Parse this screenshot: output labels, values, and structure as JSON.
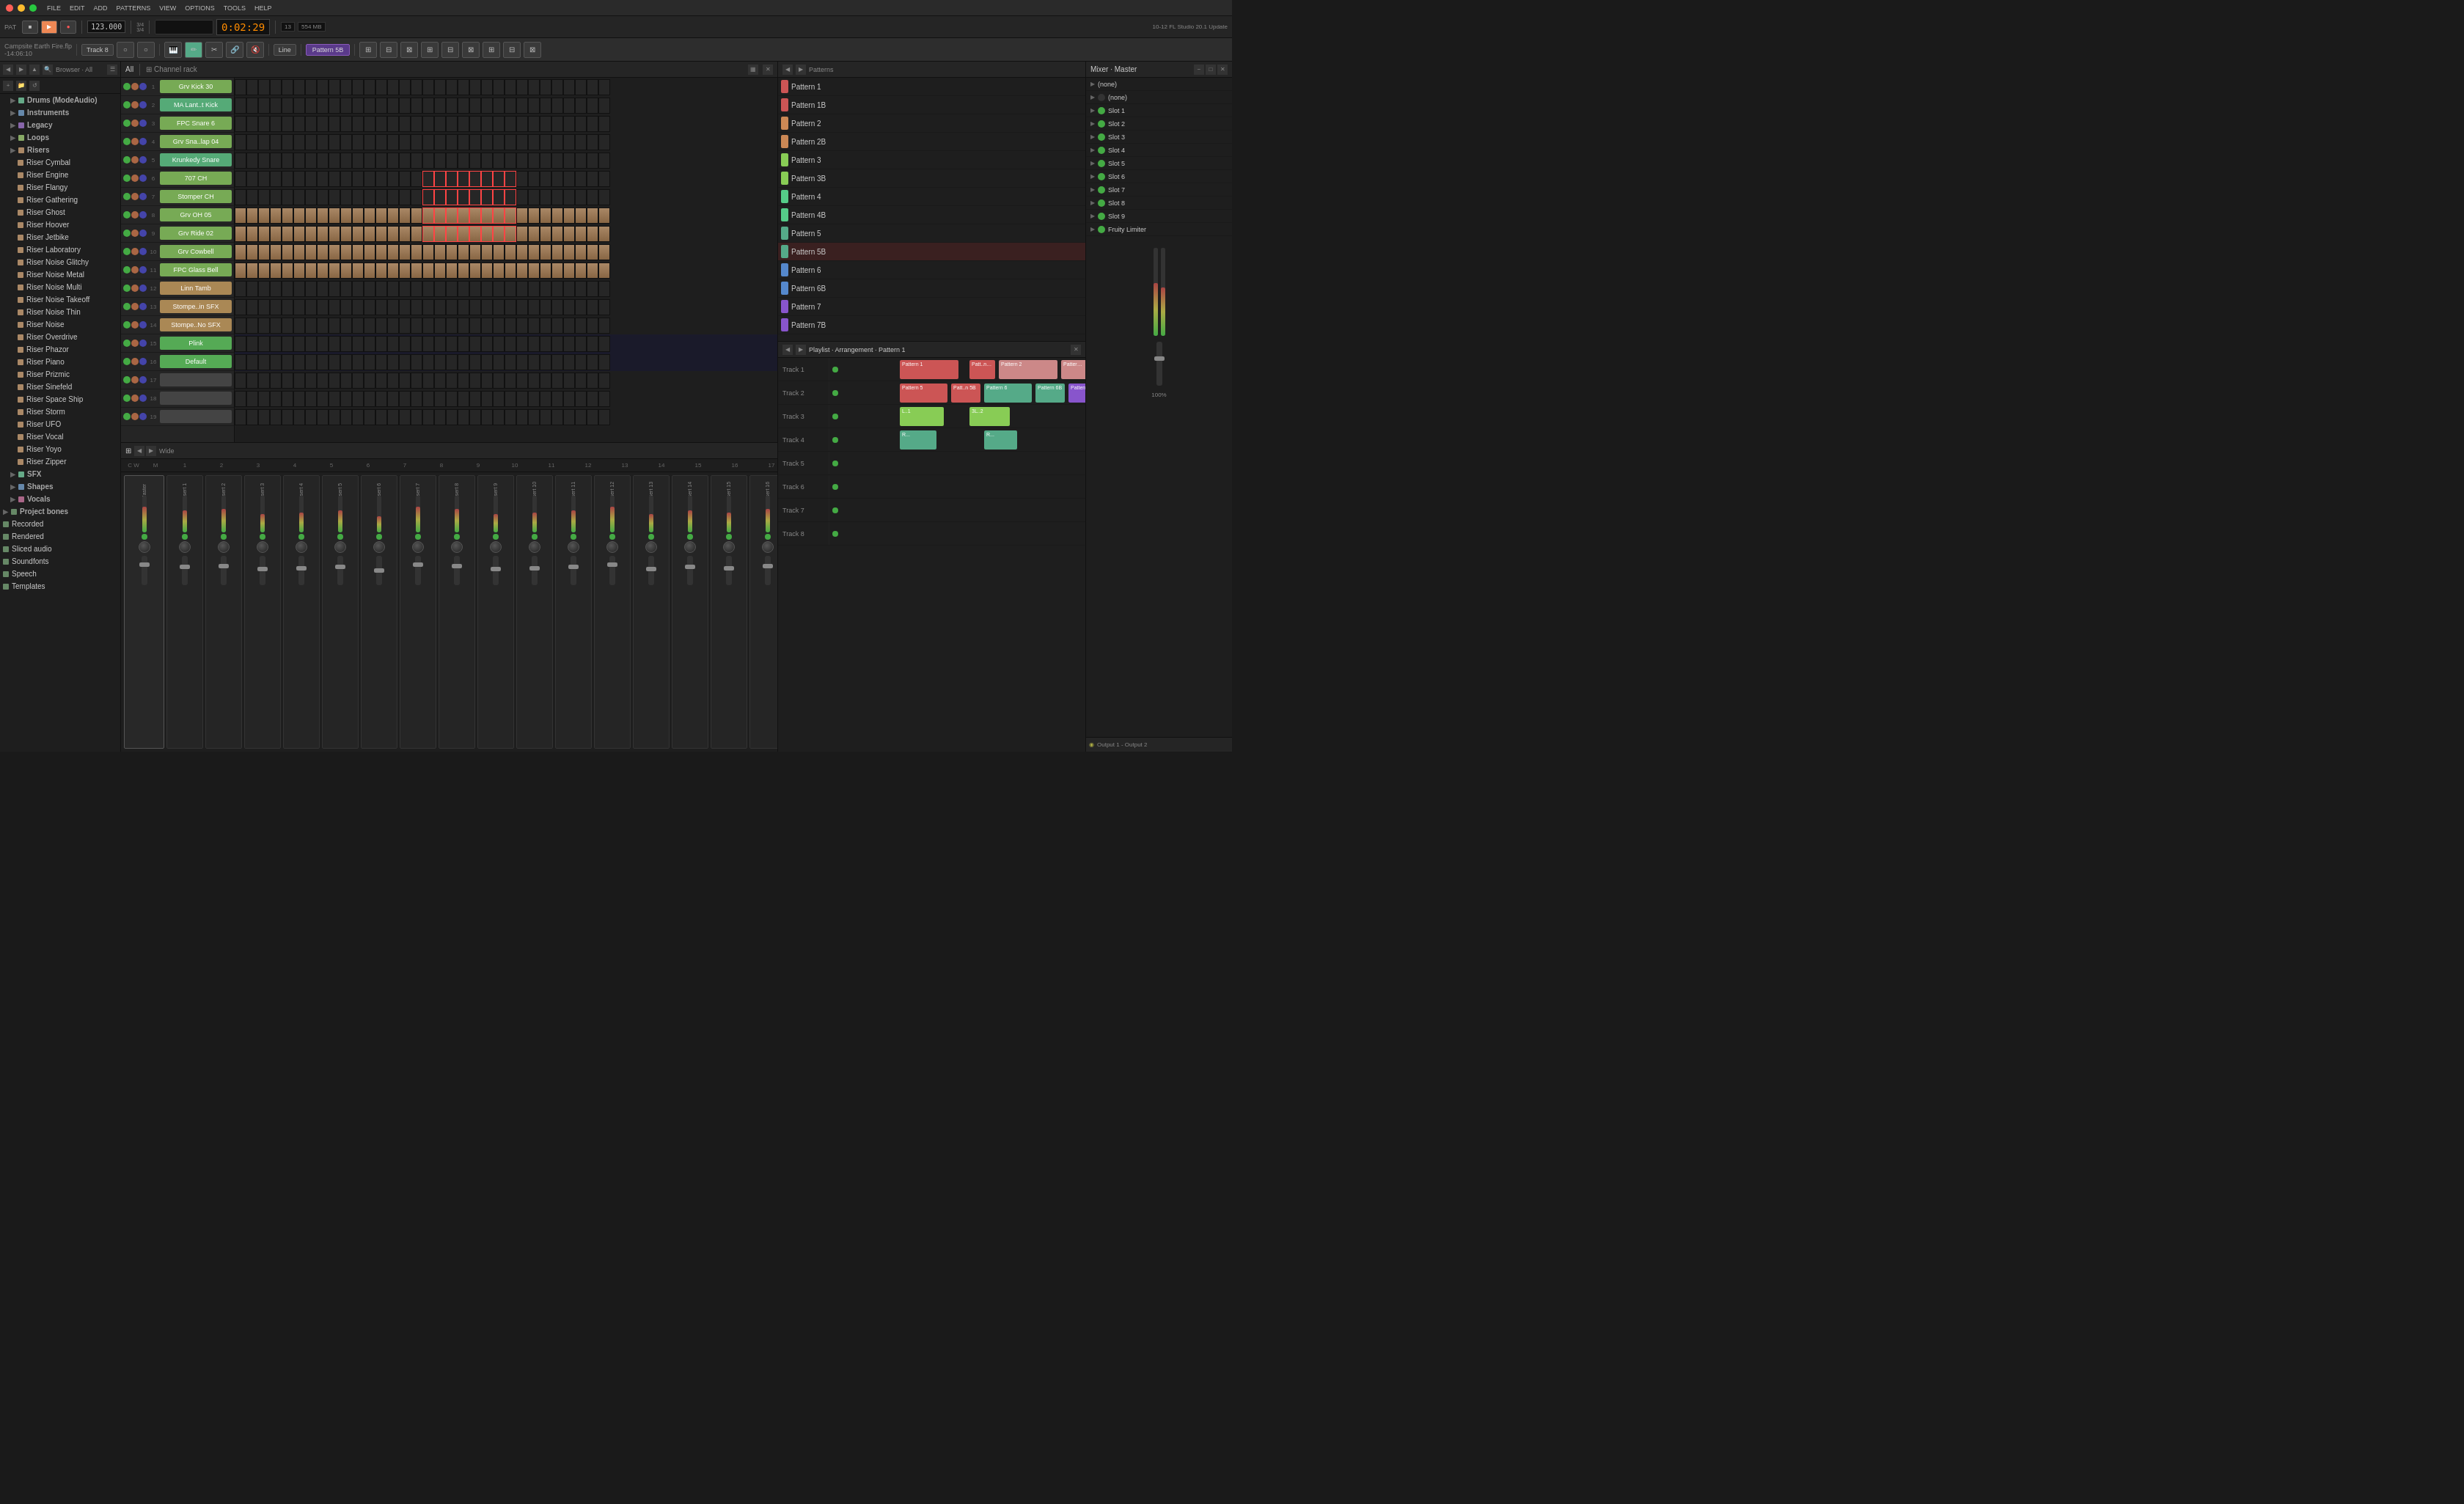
{
  "app": {
    "title": "FL Studio 20.1",
    "project": "Campsite Earth Fire.flp",
    "time_offset": "-14:06:10"
  },
  "titlebar": {
    "menus": [
      "FILE",
      "EDIT",
      "ADD",
      "PATTERNS",
      "VIEW",
      "OPTIONS",
      "TOOLS",
      "HELP"
    ],
    "pattern_label": "PAT"
  },
  "transport": {
    "bpm": "123.000",
    "time": "0:02:29",
    "track": "Track 8",
    "pattern": "Pattern 5B",
    "cpu": "13",
    "ram": "554 MB",
    "line_label": "Line",
    "update_label": "10-12  FL Studio 20.1\nUpdate"
  },
  "channel_rack": {
    "title": "Channel rack",
    "channels": [
      {
        "num": 1,
        "name": "Grv Kick 30",
        "color": "#7a5"
      },
      {
        "num": 2,
        "name": "MA Lant..t Kick",
        "color": "#5a7"
      },
      {
        "num": 3,
        "name": "FPC Snare 6",
        "color": "#7a5"
      },
      {
        "num": 4,
        "name": "Grv Sna..lap 04",
        "color": "#7a5"
      },
      {
        "num": 5,
        "name": "Krunkedy Snare",
        "color": "#5a7"
      },
      {
        "num": 6,
        "name": "707 CH",
        "color": "#7a5"
      },
      {
        "num": 7,
        "name": "Stomper CH",
        "color": "#7a5"
      },
      {
        "num": 8,
        "name": "Grv OH 05",
        "color": "#7a5"
      },
      {
        "num": 9,
        "name": "Grv Ride 02",
        "color": "#7a5"
      },
      {
        "num": 10,
        "name": "Grv Cowbell",
        "color": "#7a5"
      },
      {
        "num": 11,
        "name": "FPC Glass Bell",
        "color": "#7a5"
      },
      {
        "num": 12,
        "name": "Linn Tamb",
        "color": "#a85"
      },
      {
        "num": 13,
        "name": "Stompe..in SFX",
        "color": "#a85"
      },
      {
        "num": 14,
        "name": "Stompe..No SFX",
        "color": "#a85"
      },
      {
        "num": 15,
        "name": "Plink",
        "color": "#5a5"
      },
      {
        "num": 16,
        "name": "Default",
        "color": "#5a5"
      },
      {
        "num": 17,
        "name": "",
        "color": "#444"
      },
      {
        "num": 18,
        "name": "",
        "color": "#444"
      },
      {
        "num": 19,
        "name": "",
        "color": "#444"
      }
    ]
  },
  "browser": {
    "title": "Browser · All",
    "items": [
      {
        "label": "Drums (ModeAudio)",
        "color": "#6a8",
        "indent": 1,
        "type": "folder"
      },
      {
        "label": "Instruments",
        "color": "#68a",
        "indent": 1,
        "type": "folder"
      },
      {
        "label": "Legacy",
        "color": "#86a",
        "indent": 1,
        "type": "folder"
      },
      {
        "label": "Loops",
        "color": "#8a6",
        "indent": 1,
        "type": "folder"
      },
      {
        "label": "Risers",
        "color": "#a86",
        "indent": 1,
        "type": "folder"
      },
      {
        "label": "Riser Cymbal",
        "color": "#a86",
        "indent": 2
      },
      {
        "label": "Riser Engine",
        "color": "#a86",
        "indent": 2
      },
      {
        "label": "Riser Flangy",
        "color": "#a86",
        "indent": 2
      },
      {
        "label": "Riser Gathering",
        "color": "#a86",
        "indent": 2
      },
      {
        "label": "Riser Ghost",
        "color": "#a86",
        "indent": 2
      },
      {
        "label": "Riser Hoover",
        "color": "#a86",
        "indent": 2
      },
      {
        "label": "Riser Jetbike",
        "color": "#a86",
        "indent": 2
      },
      {
        "label": "Riser Laboratory",
        "color": "#a86",
        "indent": 2
      },
      {
        "label": "Riser Noise Glitchy",
        "color": "#a86",
        "indent": 2
      },
      {
        "label": "Riser Noise Metal",
        "color": "#a86",
        "indent": 2
      },
      {
        "label": "Riser Noise Multi",
        "color": "#a86",
        "indent": 2
      },
      {
        "label": "Riser Noise Takeoff",
        "color": "#a86",
        "indent": 2
      },
      {
        "label": "Riser Noise Thin",
        "color": "#a86",
        "indent": 2
      },
      {
        "label": "Riser Noise",
        "color": "#a86",
        "indent": 2
      },
      {
        "label": "Riser Overdrive",
        "color": "#a86",
        "indent": 2
      },
      {
        "label": "Riser Phazor",
        "color": "#a86",
        "indent": 2
      },
      {
        "label": "Riser Piano",
        "color": "#a86",
        "indent": 2
      },
      {
        "label": "Riser Prizmic",
        "color": "#a86",
        "indent": 2
      },
      {
        "label": "Riser Sinefeld",
        "color": "#a86",
        "indent": 2
      },
      {
        "label": "Riser Space Ship",
        "color": "#a86",
        "indent": 2
      },
      {
        "label": "Riser Storm",
        "color": "#a86",
        "indent": 2
      },
      {
        "label": "Riser UFO",
        "color": "#a86",
        "indent": 2
      },
      {
        "label": "Riser Vocal",
        "color": "#a86",
        "indent": 2
      },
      {
        "label": "Riser Yoyo",
        "color": "#a86",
        "indent": 2
      },
      {
        "label": "Riser Zipper",
        "color": "#a86",
        "indent": 2
      },
      {
        "label": "SFX",
        "color": "#6a8",
        "indent": 1,
        "type": "folder"
      },
      {
        "label": "Shapes",
        "color": "#68a",
        "indent": 1,
        "type": "folder"
      },
      {
        "label": "Vocals",
        "color": "#a68",
        "indent": 1,
        "type": "folder"
      },
      {
        "label": "Project bones",
        "color": "#686",
        "indent": 0,
        "type": "folder"
      },
      {
        "label": "Recorded",
        "color": "#686",
        "indent": 0
      },
      {
        "label": "Rendered",
        "color": "#686",
        "indent": 0
      },
      {
        "label": "Sliced audio",
        "color": "#686",
        "indent": 0
      },
      {
        "label": "Soundfonts",
        "color": "#686",
        "indent": 0
      },
      {
        "label": "Speech",
        "color": "#686",
        "indent": 0
      },
      {
        "label": "Templates",
        "color": "#686",
        "indent": 0
      }
    ]
  },
  "patterns": [
    {
      "name": "Pattern 1",
      "color": "#c55"
    },
    {
      "name": "Pattern 1B",
      "color": "#c55"
    },
    {
      "name": "Pattern 2",
      "color": "#c85"
    },
    {
      "name": "Pattern 2B",
      "color": "#c85"
    },
    {
      "name": "Pattern 3",
      "color": "#8c5"
    },
    {
      "name": "Pattern 3B",
      "color": "#8c5"
    },
    {
      "name": "Pattern 4",
      "color": "#5c8"
    },
    {
      "name": "Pattern 4B",
      "color": "#5c8"
    },
    {
      "name": "Pattern 5",
      "color": "#5a8"
    },
    {
      "name": "Pattern 5B",
      "color": "#5a8",
      "selected": true
    },
    {
      "name": "Pattern 6",
      "color": "#58c"
    },
    {
      "name": "Pattern 6B",
      "color": "#58c"
    },
    {
      "name": "Pattern 7",
      "color": "#85c"
    },
    {
      "name": "Pattern 7B",
      "color": "#85c"
    }
  ],
  "playlist": {
    "title": "Playlist · Arrangement · Pattern 1",
    "tracks": [
      {
        "label": "Track 1"
      },
      {
        "label": "Track 2"
      },
      {
        "label": "Track 3"
      },
      {
        "label": "Track 4"
      },
      {
        "label": "Track 5"
      },
      {
        "label": "Track 6"
      },
      {
        "label": "Track 7"
      },
      {
        "label": "Track 8"
      }
    ]
  },
  "mixer": {
    "title": "Mixer · Master",
    "slots": [
      "(none)",
      "Slot 1",
      "Slot 2",
      "Slot 3",
      "Slot 4",
      "Slot 5",
      "Slot 6",
      "Slot 7",
      "Slot 8",
      "Slot 9",
      "Fruity Limiter"
    ],
    "output": "(none)",
    "output2": "Output 1 - Output 2"
  }
}
